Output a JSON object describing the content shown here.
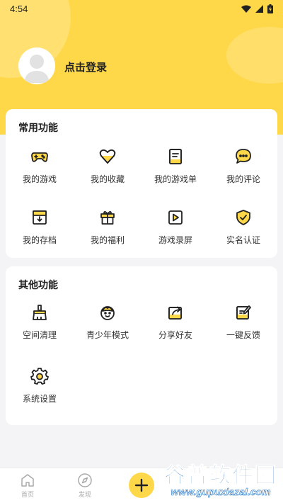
{
  "status_bar": {
    "time": "4:54"
  },
  "profile": {
    "login_label": "点击登录"
  },
  "common": {
    "title": "常用功能",
    "items": [
      {
        "label": "我的游戏",
        "icon": "gamepad-icon"
      },
      {
        "label": "我的收藏",
        "icon": "heart-icon"
      },
      {
        "label": "我的游戏单",
        "icon": "list-icon"
      },
      {
        "label": "我的评论",
        "icon": "comment-icon"
      },
      {
        "label": "我的存档",
        "icon": "archive-icon"
      },
      {
        "label": "我的福利",
        "icon": "gift-icon"
      },
      {
        "label": "游戏录屏",
        "icon": "video-icon"
      },
      {
        "label": "实名认证",
        "icon": "shield-icon"
      }
    ]
  },
  "other": {
    "title": "其他功能",
    "items": [
      {
        "label": "空间清理",
        "icon": "broom-icon"
      },
      {
        "label": "青少年模式",
        "icon": "child-face-icon"
      },
      {
        "label": "分享好友",
        "icon": "share-icon"
      },
      {
        "label": "一键反馈",
        "icon": "feedback-icon"
      },
      {
        "label": "系统设置",
        "icon": "gear-icon"
      }
    ]
  },
  "bottom_nav": {
    "home_label": "首页",
    "discover_label": "发现"
  },
  "watermark": {
    "title": "谷普软件园",
    "url": "www.gupuxlazal.com"
  },
  "colors": {
    "accent": "#ffd84a",
    "icon_stroke": "#222222",
    "background": "#f4f4f6"
  }
}
